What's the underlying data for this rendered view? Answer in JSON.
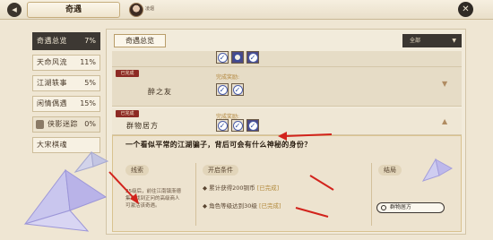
{
  "topbar": {
    "back_icon": "back-icon",
    "title": "奇遇",
    "player_name": "凌烟",
    "close_icon": "close-icon"
  },
  "sidemenu": {
    "items": [
      {
        "label": "奇遇总览",
        "pct": "7%",
        "active": true
      },
      {
        "label": "天命风流",
        "pct": "11%"
      },
      {
        "label": "江湖轶事",
        "pct": "5%"
      },
      {
        "label": "闲情偶遇",
        "pct": "15%"
      },
      {
        "label": "侠影迷踪",
        "pct": "0%",
        "locked": true
      },
      {
        "label": "大宋棋魂"
      }
    ]
  },
  "main": {
    "section_title": "奇遇总览",
    "filter": {
      "value": "全部"
    },
    "rows": [
      {
        "badge": "已完成",
        "name": "",
        "reward_label": "",
        "rewards": [
          "check",
          "purple-check",
          "purple-check"
        ]
      },
      {
        "badge": "已完成",
        "name": "醉之友",
        "reward_label": "完成奖励:",
        "rewards": [
          "check",
          "check"
        ]
      },
      {
        "badge": "已完成",
        "name": "群物居方",
        "reward_label": "完成奖励:",
        "rewards": [
          "check",
          "check",
          "purple-check"
        ]
      }
    ],
    "detail": {
      "description": "一个看似平常的江湖骗子，背后可会有什么神秘的身份？",
      "clue_title": "线索",
      "clue_text": "25级后，前往江南镇渐德集市找到正问的高级商人可激活该奇遇。",
      "conditions_title": "开启条件",
      "conditions": [
        {
          "text": "累计获得200铜币",
          "status": "[已完成]"
        },
        {
          "text": "角色等级达到30级",
          "status": "[已完成]"
        }
      ],
      "result_title": "结局",
      "result_value": "群物居方"
    }
  },
  "colors": {
    "badge": "#8d2a24",
    "accent": "#b2863c",
    "annotation": "#d2231c"
  }
}
